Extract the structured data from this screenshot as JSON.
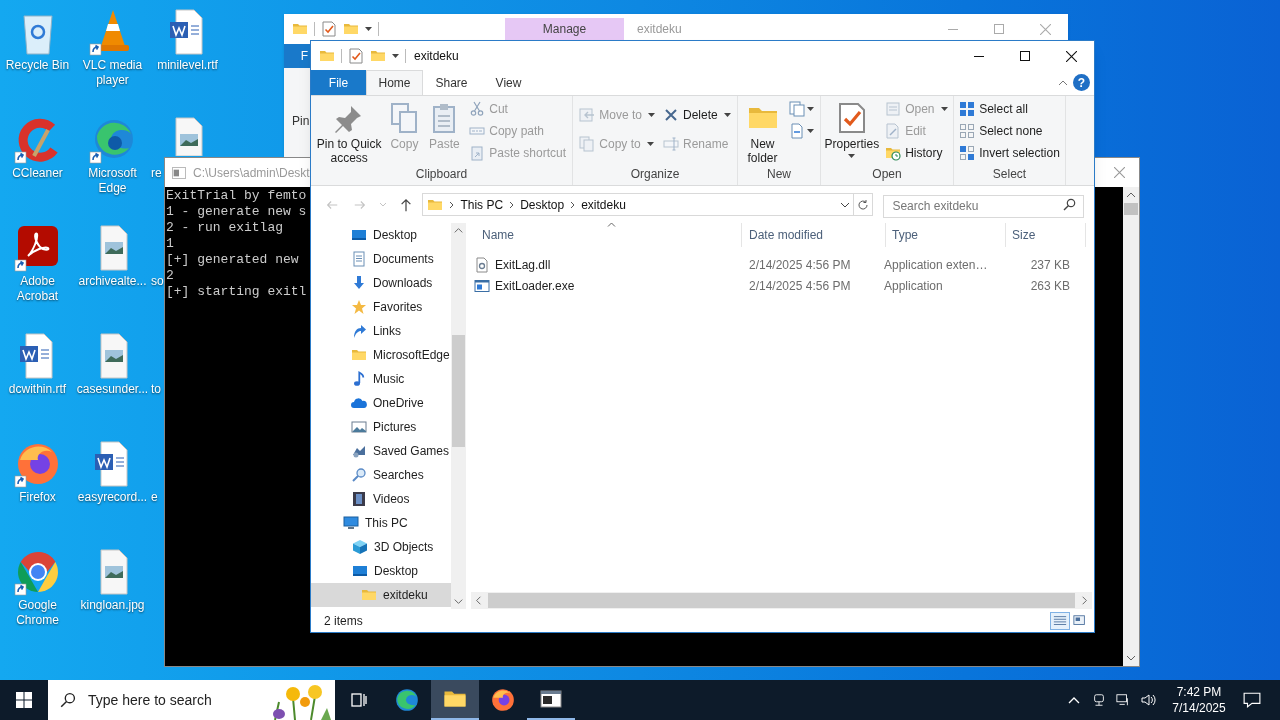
{
  "desktop_icons": [
    {
      "label": "Recycle Bin",
      "kind": "recycle",
      "shortcut": false,
      "cut": false
    },
    {
      "label": "VLC media player",
      "kind": "vlc",
      "shortcut": true,
      "cut": false
    },
    {
      "label": "minilevel.rtf",
      "kind": "word",
      "shortcut": false,
      "cut": false
    },
    {
      "label": "CCleaner",
      "kind": "ccleaner",
      "shortcut": true,
      "cut": false
    },
    {
      "label": "Microsoft Edge",
      "kind": "edge",
      "shortcut": true,
      "cut": false
    },
    {
      "label": "re",
      "kind": "image",
      "cut": true
    },
    {
      "label": "Adobe Acrobat",
      "kind": "acrobat",
      "shortcut": true,
      "cut": false
    },
    {
      "label": "archivealte...",
      "kind": "image",
      "shortcut": false,
      "cut": false
    },
    {
      "label": "so",
      "kind": "hidden",
      "cut": true
    },
    {
      "label": "dcwithin.rtf",
      "kind": "word",
      "shortcut": false,
      "cut": false
    },
    {
      "label": "casesunder...",
      "kind": "image",
      "shortcut": false,
      "cut": false
    },
    {
      "label": "to",
      "kind": "hidden",
      "cut": true
    },
    {
      "label": "Firefox",
      "kind": "firefox",
      "shortcut": true,
      "cut": false
    },
    {
      "label": "easyrecord...",
      "kind": "word",
      "shortcut": false,
      "cut": false
    },
    {
      "label": "e",
      "kind": "hidden",
      "cut": true
    },
    {
      "label": "Google Chrome",
      "kind": "chrome",
      "shortcut": true,
      "cut": false
    },
    {
      "label": "kingloan.jpg",
      "kind": "image",
      "shortcut": false,
      "cut": false
    }
  ],
  "back_window": {
    "tab": "Manage",
    "title": "exitdeku",
    "file_tab": "F",
    "ribbon_text": "Pin"
  },
  "console": {
    "title": "C:\\Users\\admin\\Deskt",
    "lines": [
      "ExitTrial by femto",
      "1 - generate new s",
      "2 - run exitlag",
      "1",
      "[+] generated new",
      "2",
      "[+] starting exitl"
    ]
  },
  "explorer": {
    "title": "exitdeku",
    "help": "?",
    "tabs": [
      {
        "label": "File",
        "kind": "file",
        "selected": false
      },
      {
        "label": "Home",
        "kind": "tab",
        "selected": true
      },
      {
        "label": "Share",
        "kind": "tab",
        "selected": false
      },
      {
        "label": "View",
        "kind": "tab",
        "selected": false
      }
    ],
    "ribbon": {
      "clipboard": {
        "label": "Clipboard",
        "pin": {
          "label": "Pin to Quick access",
          "disabled": false
        },
        "copy": {
          "label": "Copy",
          "disabled": true
        },
        "paste": {
          "label": "Paste",
          "disabled": true
        },
        "cut": {
          "label": "Cut",
          "disabled": true
        },
        "copy_path": {
          "label": "Copy path",
          "disabled": true
        },
        "paste_shortcut": {
          "label": "Paste shortcut",
          "disabled": true
        }
      },
      "organize": {
        "label": "Organize",
        "move_to": {
          "label": "Move to",
          "disabled": true
        },
        "copy_to": {
          "label": "Copy to",
          "disabled": true
        },
        "delete": {
          "label": "Delete",
          "disabled": false
        },
        "rename": {
          "label": "Rename",
          "disabled": true
        }
      },
      "new": {
        "label": "New",
        "new_folder": {
          "label": "New folder",
          "disabled": false
        }
      },
      "open": {
        "label": "Open",
        "properties": {
          "label": "Properties",
          "disabled": false
        },
        "open": {
          "label": "Open",
          "disabled": true
        },
        "edit": {
          "label": "Edit",
          "disabled": true
        },
        "history": {
          "label": "History",
          "disabled": false
        }
      },
      "select": {
        "label": "Select",
        "select_all": {
          "label": "Select all",
          "disabled": false
        },
        "select_none": {
          "label": "Select none",
          "disabled": false
        },
        "invert_selection": {
          "label": "Invert selection",
          "disabled": false
        }
      }
    },
    "address": {
      "path": [
        "This PC",
        "Desktop",
        "exitdeku"
      ]
    },
    "search": {
      "placeholder": "Search exitdeku"
    },
    "nav": {
      "quick_items": [
        {
          "label": "Desktop",
          "kind": "desktop",
          "selected": false
        },
        {
          "label": "Documents",
          "kind": "documents",
          "selected": false
        },
        {
          "label": "Downloads",
          "kind": "downloads",
          "selected": false
        },
        {
          "label": "Favorites",
          "kind": "favorites",
          "selected": false
        },
        {
          "label": "Links",
          "kind": "links",
          "selected": false
        },
        {
          "label": "MicrosoftEdge",
          "kind": "folder",
          "selected": false
        },
        {
          "label": "Music",
          "kind": "music",
          "selected": false
        },
        {
          "label": "OneDrive",
          "kind": "onedrive",
          "selected": false
        },
        {
          "label": "Pictures",
          "kind": "pictures",
          "selected": false
        },
        {
          "label": "Saved Games",
          "kind": "games",
          "selected": false
        },
        {
          "label": "Searches",
          "kind": "searches",
          "selected": false
        },
        {
          "label": "Videos",
          "kind": "videos",
          "selected": false
        }
      ],
      "tree": [
        {
          "label": "This PC",
          "kind": "pc",
          "selected": false,
          "children": [
            {
              "label": "3D Objects",
              "kind": "objects3d",
              "selected": false
            },
            {
              "label": "Desktop",
              "kind": "desktop",
              "selected": false,
              "children": [
                {
                  "label": "exitdeku",
                  "kind": "folder",
                  "selected": true
                }
              ]
            }
          ]
        }
      ]
    },
    "columns": [
      "Name",
      "Date modified",
      "Type",
      "Size"
    ],
    "files": [
      {
        "name": "ExitLag.dll",
        "kind": "dll",
        "date": "2/14/2025 4:56 PM",
        "type": "Application exten…",
        "size": "237 KB"
      },
      {
        "name": "ExitLoader.exe",
        "kind": "exe",
        "date": "2/14/2025 4:56 PM",
        "type": "Application",
        "size": "263 KB"
      }
    ],
    "status": "2 items",
    "views": [
      {
        "kind": "details",
        "selected": true
      },
      {
        "kind": "tiles",
        "selected": false
      }
    ]
  },
  "taskbar": {
    "search_placeholder": "Type here to search",
    "apps": [
      {
        "kind": "taskview",
        "running": false,
        "active": false
      },
      {
        "kind": "edge",
        "running": false,
        "active": false
      },
      {
        "kind": "explorer",
        "running": true,
        "active": true
      },
      {
        "kind": "firefox",
        "running": false,
        "active": false
      },
      {
        "kind": "console",
        "running": true,
        "active": false
      }
    ],
    "time": "7:42 PM",
    "date": "7/14/2025"
  }
}
